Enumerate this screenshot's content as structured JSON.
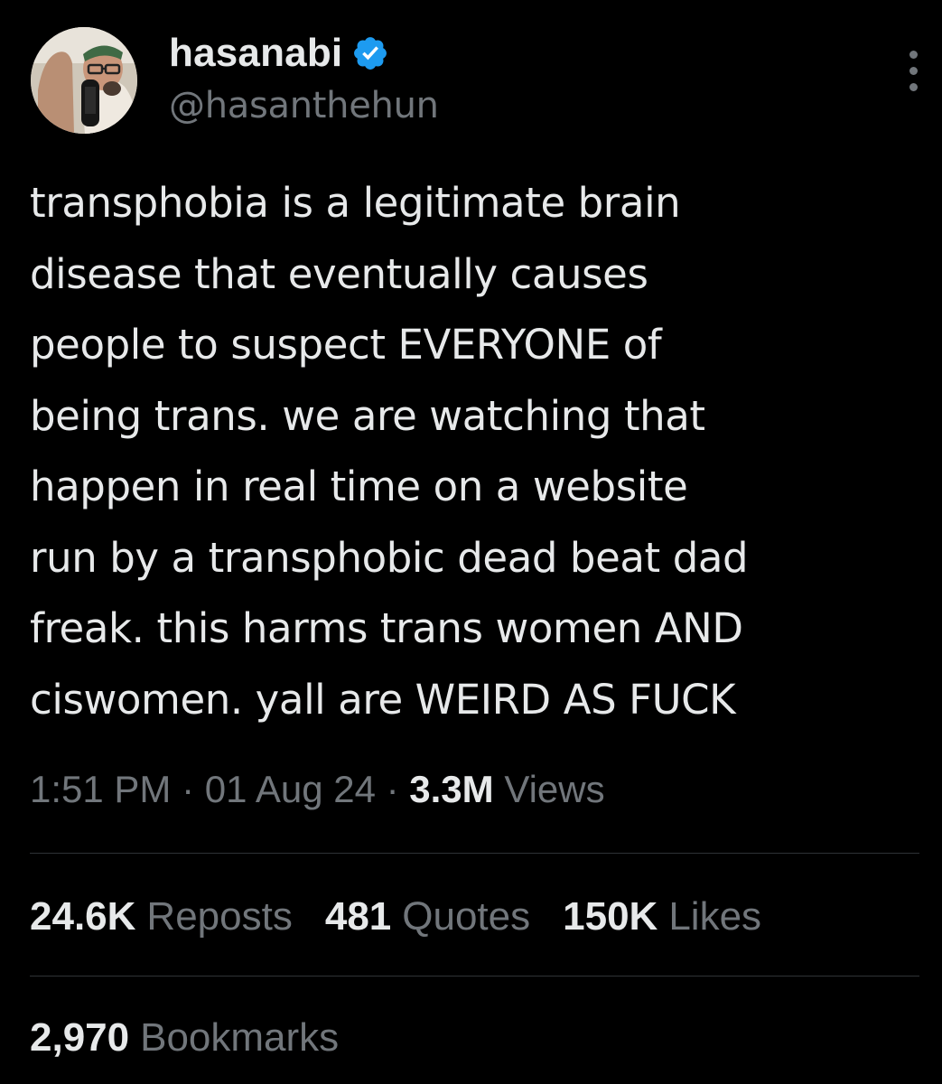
{
  "author": {
    "display_name": "hasanabi",
    "handle": "@hasanthehun",
    "verified_icon": "verified-badge-icon",
    "verified_color": "#1d9bf0",
    "avatar_icon": "avatar-photo"
  },
  "menu": {
    "icon": "more-options-icon"
  },
  "tweet": {
    "text": "transphobia is a legitimate brain\ndisease that eventually causes\npeople to suspect EVERYONE of\nbeing trans. we are watching that\nhappen in real time on a website\nrun by a transphobic dead beat dad\nfreak. this harms trans women AND\nciswomen. yall are WEIRD AS FUCK",
    "time": "1:51 PM",
    "date": "01 Aug 24",
    "separator": "·",
    "views_count": "3.3M",
    "views_label": "Views"
  },
  "stats": {
    "reposts_count": "24.6K",
    "reposts_label": "Reposts",
    "quotes_count": "481",
    "quotes_label": "Quotes",
    "likes_count": "150K",
    "likes_label": "Likes",
    "bookmarks_count": "2,970",
    "bookmarks_label": "Bookmarks"
  },
  "colors": {
    "background": "#000000",
    "primary_text": "#e7e9ea",
    "secondary_text": "#71767b",
    "divider": "#2f3336",
    "accent": "#1d9bf0"
  }
}
